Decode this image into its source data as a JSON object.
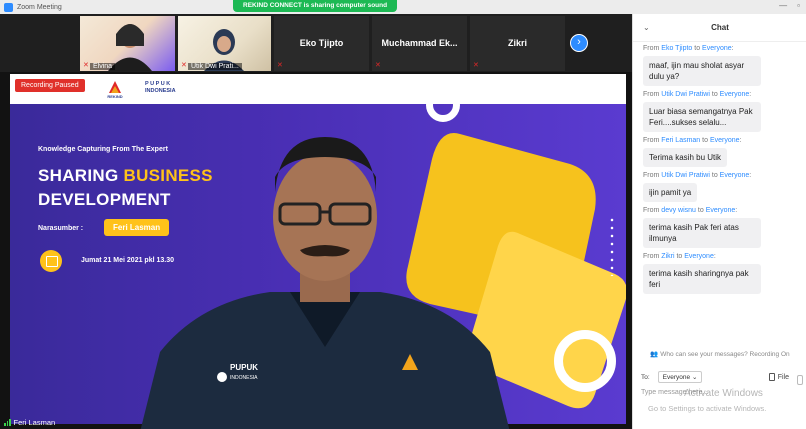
{
  "titlebar": {
    "app_title": "Zoom Meeting",
    "banner": "REKIND CONNECT is sharing computer sound",
    "minimize": "—",
    "restore": "▫"
  },
  "strip": {
    "tiles": [
      {
        "name": "Elvina"
      },
      {
        "name": "Utik Dwi Prati..."
      },
      {
        "name": "Eko Tjipto"
      },
      {
        "name": "Muchammad  Ek..."
      },
      {
        "name": "Zikri"
      }
    ],
    "next": "›"
  },
  "slide": {
    "recording_status": "Recording Paused",
    "logo1_text": "REKIND",
    "logo2_line1": "P U P U K",
    "logo2_line2": "INDONESIA",
    "kicker": "Knowledge Capturing From The Expert",
    "title_a": "SHARING ",
    "title_b": "BUSINESS",
    "title_c": "DEVELOPMENT",
    "speaker_label": "Narasumber :",
    "speaker": "Feri Lasman",
    "date": "Jumat 21 Mei 2021 pkl 13.30",
    "shirt_logo_line1": "PUPUK",
    "shirt_logo_line2": "INDONESIA",
    "presenter": "Feri Lasman"
  },
  "chat": {
    "title": "Chat",
    "messages": [
      {
        "from": "Eko Tjipto",
        "to": "Everyone",
        "text": "maaf, ijin mau sholat asyar dulu ya?"
      },
      {
        "from": "Utik Dwi Pratiwi",
        "to": "Everyone",
        "text": "Luar biasa semangatnya Pak Feri....sukses selalu..."
      },
      {
        "from": "Feri Lasman",
        "to": "Everyone",
        "text": "Terima kasih bu Utik"
      },
      {
        "from": "Utik Dwi Pratiwi",
        "to": "Everyone",
        "text": "ijin pamit ya"
      },
      {
        "from": "devy wisnu",
        "to": "Everyone",
        "text": "terima kasih Pak feri atas ilmunya"
      },
      {
        "from": "Zikri",
        "to": "Everyone",
        "text": "terima kasih sharingnya pak feri"
      }
    ],
    "from_word": "From",
    "to_word": "to",
    "privacy": "Who can see your messages? Recording On",
    "to_label": "To:",
    "to_value": "Everyone",
    "file_label": "File",
    "input_placeholder": "Type message here...",
    "watermark_title": "Activate Windows",
    "watermark_sub": "Go to Settings to activate Windows."
  },
  "colors": {
    "accent": "#2d8cff",
    "highlight": "#ffc21a",
    "recording": "#e0302a",
    "slide_bg": "#4a2fb5"
  }
}
